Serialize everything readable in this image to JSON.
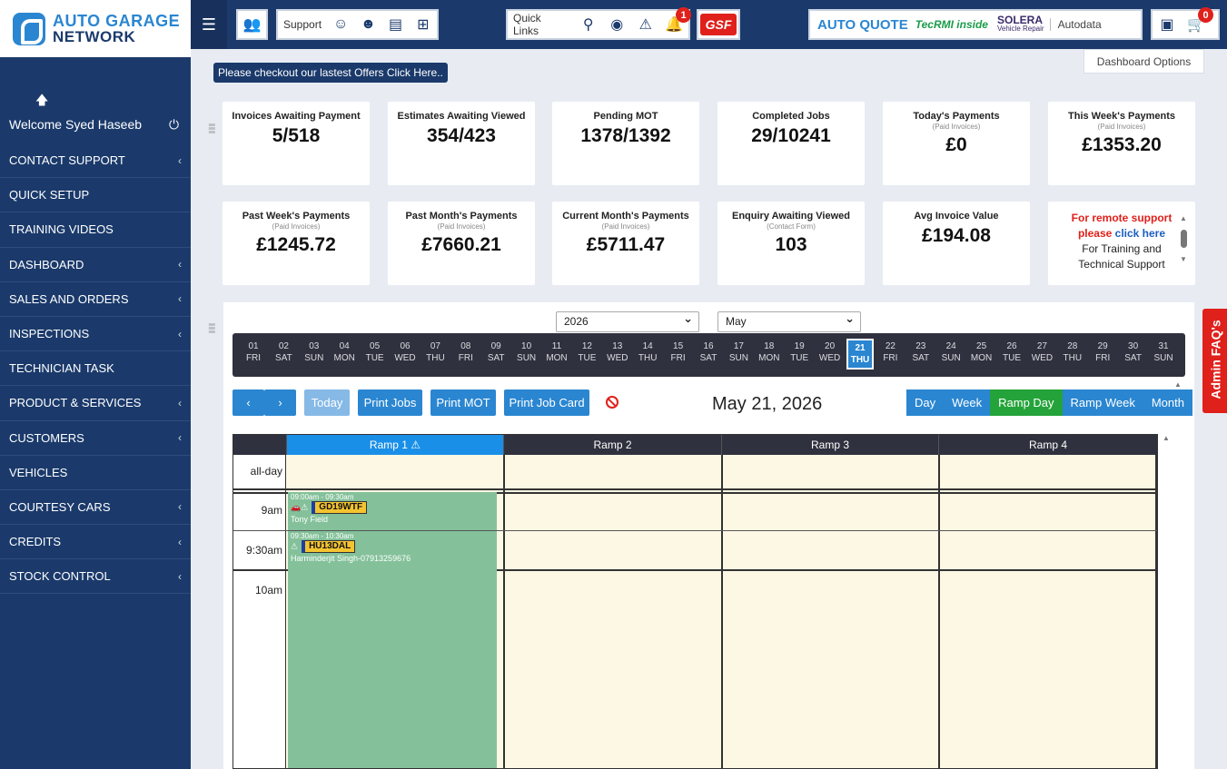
{
  "brand": {
    "line1": "AUTO GARAGE",
    "line2": "NETWORK"
  },
  "topbar": {
    "support_label": "Support",
    "quick_links_label": "Quick Links",
    "notification_count": "1",
    "gsf_label": "GSF",
    "auto_quote": "AUTO QUOTE",
    "tecrmi": "TecRMI inside",
    "solera": "SOLERA",
    "solera_sub": "Vehicle Repair",
    "autodata": "Autodata",
    "cart_count": "0"
  },
  "sidebar": {
    "welcome": "Welcome Syed Haseeb",
    "items": [
      {
        "label": "CONTACT SUPPORT",
        "has_children": true
      },
      {
        "label": "QUICK SETUP",
        "has_children": false
      },
      {
        "label": "TRAINING VIDEOS",
        "has_children": false
      },
      {
        "label": "DASHBOARD",
        "has_children": true
      },
      {
        "label": "SALES AND ORDERS",
        "has_children": true
      },
      {
        "label": "INSPECTIONS",
        "has_children": true
      },
      {
        "label": "TECHNICIAN TASK",
        "has_children": false
      },
      {
        "label": "PRODUCT & SERVICES",
        "has_children": true
      },
      {
        "label": "CUSTOMERS",
        "has_children": true
      },
      {
        "label": "VEHICLES",
        "has_children": false
      },
      {
        "label": "COURTESY CARS",
        "has_children": true
      },
      {
        "label": "CREDITS",
        "has_children": true
      },
      {
        "label": "STOCK CONTROL",
        "has_children": true
      }
    ]
  },
  "offer_banner": "Please checkout our lastest Offers Click Here..",
  "dashboard_options": "Dashboard Options",
  "cards": [
    {
      "title": "Invoices Awaiting Payment",
      "sub": "",
      "value": "5/518"
    },
    {
      "title": "Estimates Awaiting Viewed",
      "sub": "",
      "value": "354/423"
    },
    {
      "title": "Pending MOT",
      "sub": "",
      "value": "1378/1392"
    },
    {
      "title": "Completed Jobs",
      "sub": "",
      "value": "29/10241"
    },
    {
      "title": "Today's Payments",
      "sub": "(Paid Invoices)",
      "value": "£0"
    },
    {
      "title": "This Week's Payments",
      "sub": "(Paid Invoices)",
      "value": "£1353.20"
    },
    {
      "title": "Past Week's Payments",
      "sub": "(Paid Invoices)",
      "value": "£1245.72"
    },
    {
      "title": "Past Month's Payments",
      "sub": "(Paid Invoices)",
      "value": "£7660.21"
    },
    {
      "title": "Current Month's Payments",
      "sub": "(Paid Invoices)",
      "value": "£5711.47"
    },
    {
      "title": "Enquiry Awaiting Viewed",
      "sub": "(Contact Form)",
      "value": "103"
    },
    {
      "title": "Avg Invoice Value",
      "sub": "",
      "value": "£194.08"
    }
  ],
  "support_card": {
    "line1": "For remote support",
    "line2a": "please ",
    "line2b": "click here",
    "line3": "For Training and",
    "line4": "Technical Support"
  },
  "calendar": {
    "year": "2026",
    "month": "May",
    "selected_day": "21",
    "days": [
      [
        "01",
        "FRI"
      ],
      [
        "02",
        "SAT"
      ],
      [
        "03",
        "SUN"
      ],
      [
        "04",
        "MON"
      ],
      [
        "05",
        "TUE"
      ],
      [
        "06",
        "WED"
      ],
      [
        "07",
        "THU"
      ],
      [
        "08",
        "FRI"
      ],
      [
        "09",
        "SAT"
      ],
      [
        "10",
        "SUN"
      ],
      [
        "11",
        "MON"
      ],
      [
        "12",
        "TUE"
      ],
      [
        "13",
        "WED"
      ],
      [
        "14",
        "THU"
      ],
      [
        "15",
        "FRI"
      ],
      [
        "16",
        "SAT"
      ],
      [
        "17",
        "SUN"
      ],
      [
        "18",
        "MON"
      ],
      [
        "19",
        "TUE"
      ],
      [
        "20",
        "WED"
      ],
      [
        "21",
        "THU"
      ],
      [
        "22",
        "FRI"
      ],
      [
        "23",
        "SAT"
      ],
      [
        "24",
        "SUN"
      ],
      [
        "25",
        "MON"
      ],
      [
        "26",
        "TUE"
      ],
      [
        "27",
        "WED"
      ],
      [
        "28",
        "THU"
      ],
      [
        "29",
        "FRI"
      ],
      [
        "30",
        "SAT"
      ],
      [
        "31",
        "SUN"
      ]
    ],
    "buttons": {
      "prev": "‹",
      "next": "›",
      "today": "Today",
      "print_jobs": "Print Jobs",
      "print_mot": "Print MOT",
      "print_job_card": "Print Job Card"
    },
    "title": "May 21, 2026",
    "views": [
      "Day",
      "Week",
      "Ramp Day",
      "Ramp Week",
      "Month"
    ],
    "active_view": "Ramp Day",
    "ramps": [
      "Ramp 1",
      "Ramp 2",
      "Ramp 3",
      "Ramp 4"
    ],
    "all_day": "all-day",
    "times": [
      "9am",
      "9:30am",
      "10am"
    ],
    "events": [
      {
        "time": "09:00am - 09:30am",
        "reg": "GD19WTF",
        "name": "Tony Field"
      },
      {
        "time": "09:30am - 10:30am",
        "reg": "HU13DAL",
        "name": "Harminderjit Singh-07913259676"
      }
    ]
  },
  "admin_faq": "Admin FAQ's",
  "colors": {
    "navy": "#1b3a6b",
    "blue": "#2a86d1",
    "green": "#24a33a",
    "event": "#84c19a",
    "red": "#e0201b"
  }
}
